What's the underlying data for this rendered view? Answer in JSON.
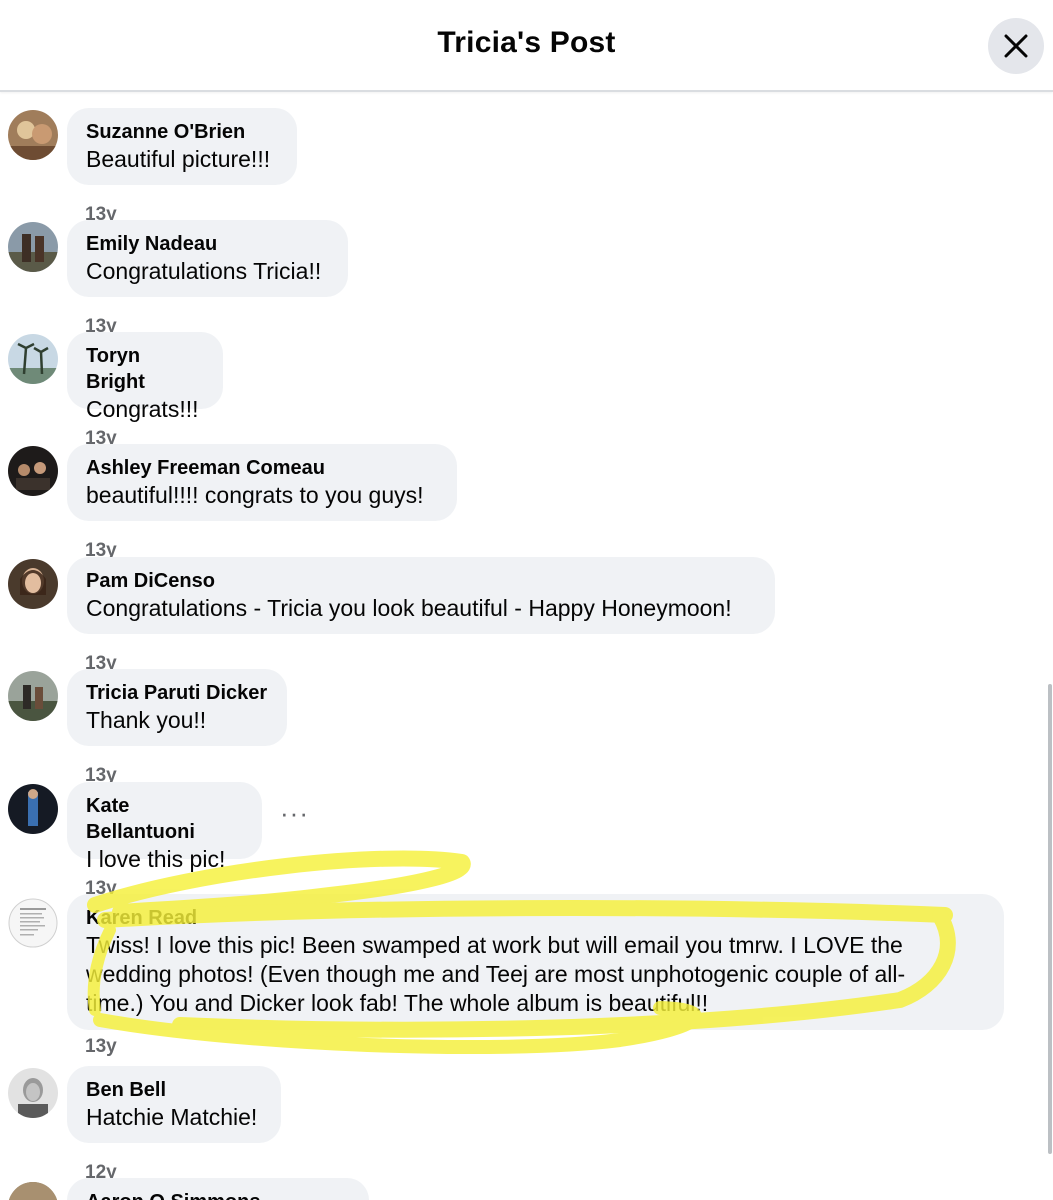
{
  "header": {
    "title": "Tricia's Post",
    "close_icon": "close-icon"
  },
  "comments": [
    {
      "author": "Suzanne O'Brien",
      "text": "Beautiful picture!!!",
      "time": "13y"
    },
    {
      "author": "Emily Nadeau",
      "text": "Congratulations Tricia!!",
      "time": "13y"
    },
    {
      "author": "Toryn Bright",
      "text": "Congrats!!!",
      "time": "13y"
    },
    {
      "author": "Ashley Freeman Comeau",
      "text": "beautiful!!!! congrats to you guys!",
      "time": "13y"
    },
    {
      "author": "Pam DiCenso",
      "text": "Congratulations - Tricia you look beautiful - Happy Honeymoon!",
      "time": "13y"
    },
    {
      "author": "Tricia Paruti Dicker",
      "text": "Thank you!!",
      "time": "13y"
    },
    {
      "author": "Kate Bellantuoni",
      "text": "I love this pic!",
      "time": "13y",
      "more_label": "···"
    },
    {
      "author": "Karen Read",
      "text_lines": [
        "Twiss! I love this pic! Been swamped at work but will email you tmrw. I LOVE the",
        "wedding photos! (Even though me and Teej are most unphotogenic couple of all-",
        "time.) You and Dicker look fab! The whole album is beautiful!!"
      ],
      "time": "13y"
    },
    {
      "author": "Ben Bell",
      "text": "Hatchie Matchie!",
      "time": "12y"
    },
    {
      "author": "Aaron O Simmons",
      "text": "",
      "time": ""
    }
  ],
  "colors": {
    "bubble": "#f0f2f5",
    "highlight": "#f5f03a",
    "meta": "#65676b"
  }
}
